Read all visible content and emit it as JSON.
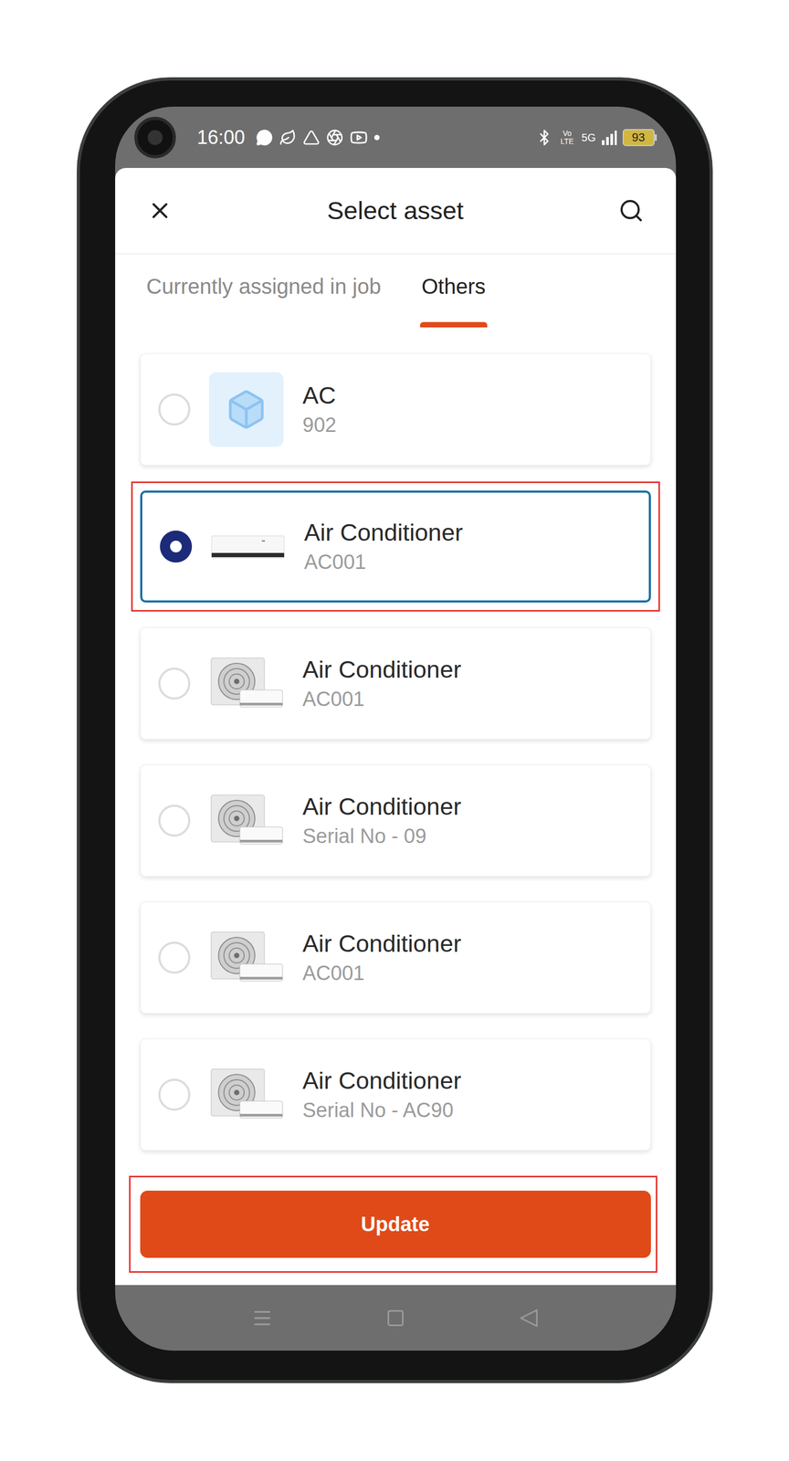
{
  "status_bar": {
    "time": "16:00",
    "volte": "Vo LTE",
    "network": "5G",
    "battery": "93"
  },
  "header": {
    "title": "Select asset"
  },
  "tabs": [
    {
      "label": "Currently assigned in job",
      "selected": false
    },
    {
      "label": "Others",
      "selected": true
    }
  ],
  "assets": [
    {
      "name": "AC",
      "code": "902",
      "kind": "cube",
      "selected": false,
      "highlighted": false
    },
    {
      "name": "Air Conditioner",
      "code": "AC001",
      "kind": "indoor",
      "selected": true,
      "highlighted": true
    },
    {
      "name": "Air Conditioner",
      "code": "AC001",
      "kind": "split",
      "selected": false,
      "highlighted": false
    },
    {
      "name": "Air Conditioner",
      "code": "Serial No - 09",
      "kind": "split",
      "selected": false,
      "highlighted": false
    },
    {
      "name": "Air Conditioner",
      "code": "AC001",
      "kind": "split",
      "selected": false,
      "highlighted": false
    },
    {
      "name": "Air Conditioner",
      "code": "Serial No - AC90",
      "kind": "split",
      "selected": false,
      "highlighted": false
    }
  ],
  "update_button": {
    "label": "Update",
    "highlighted": true
  }
}
